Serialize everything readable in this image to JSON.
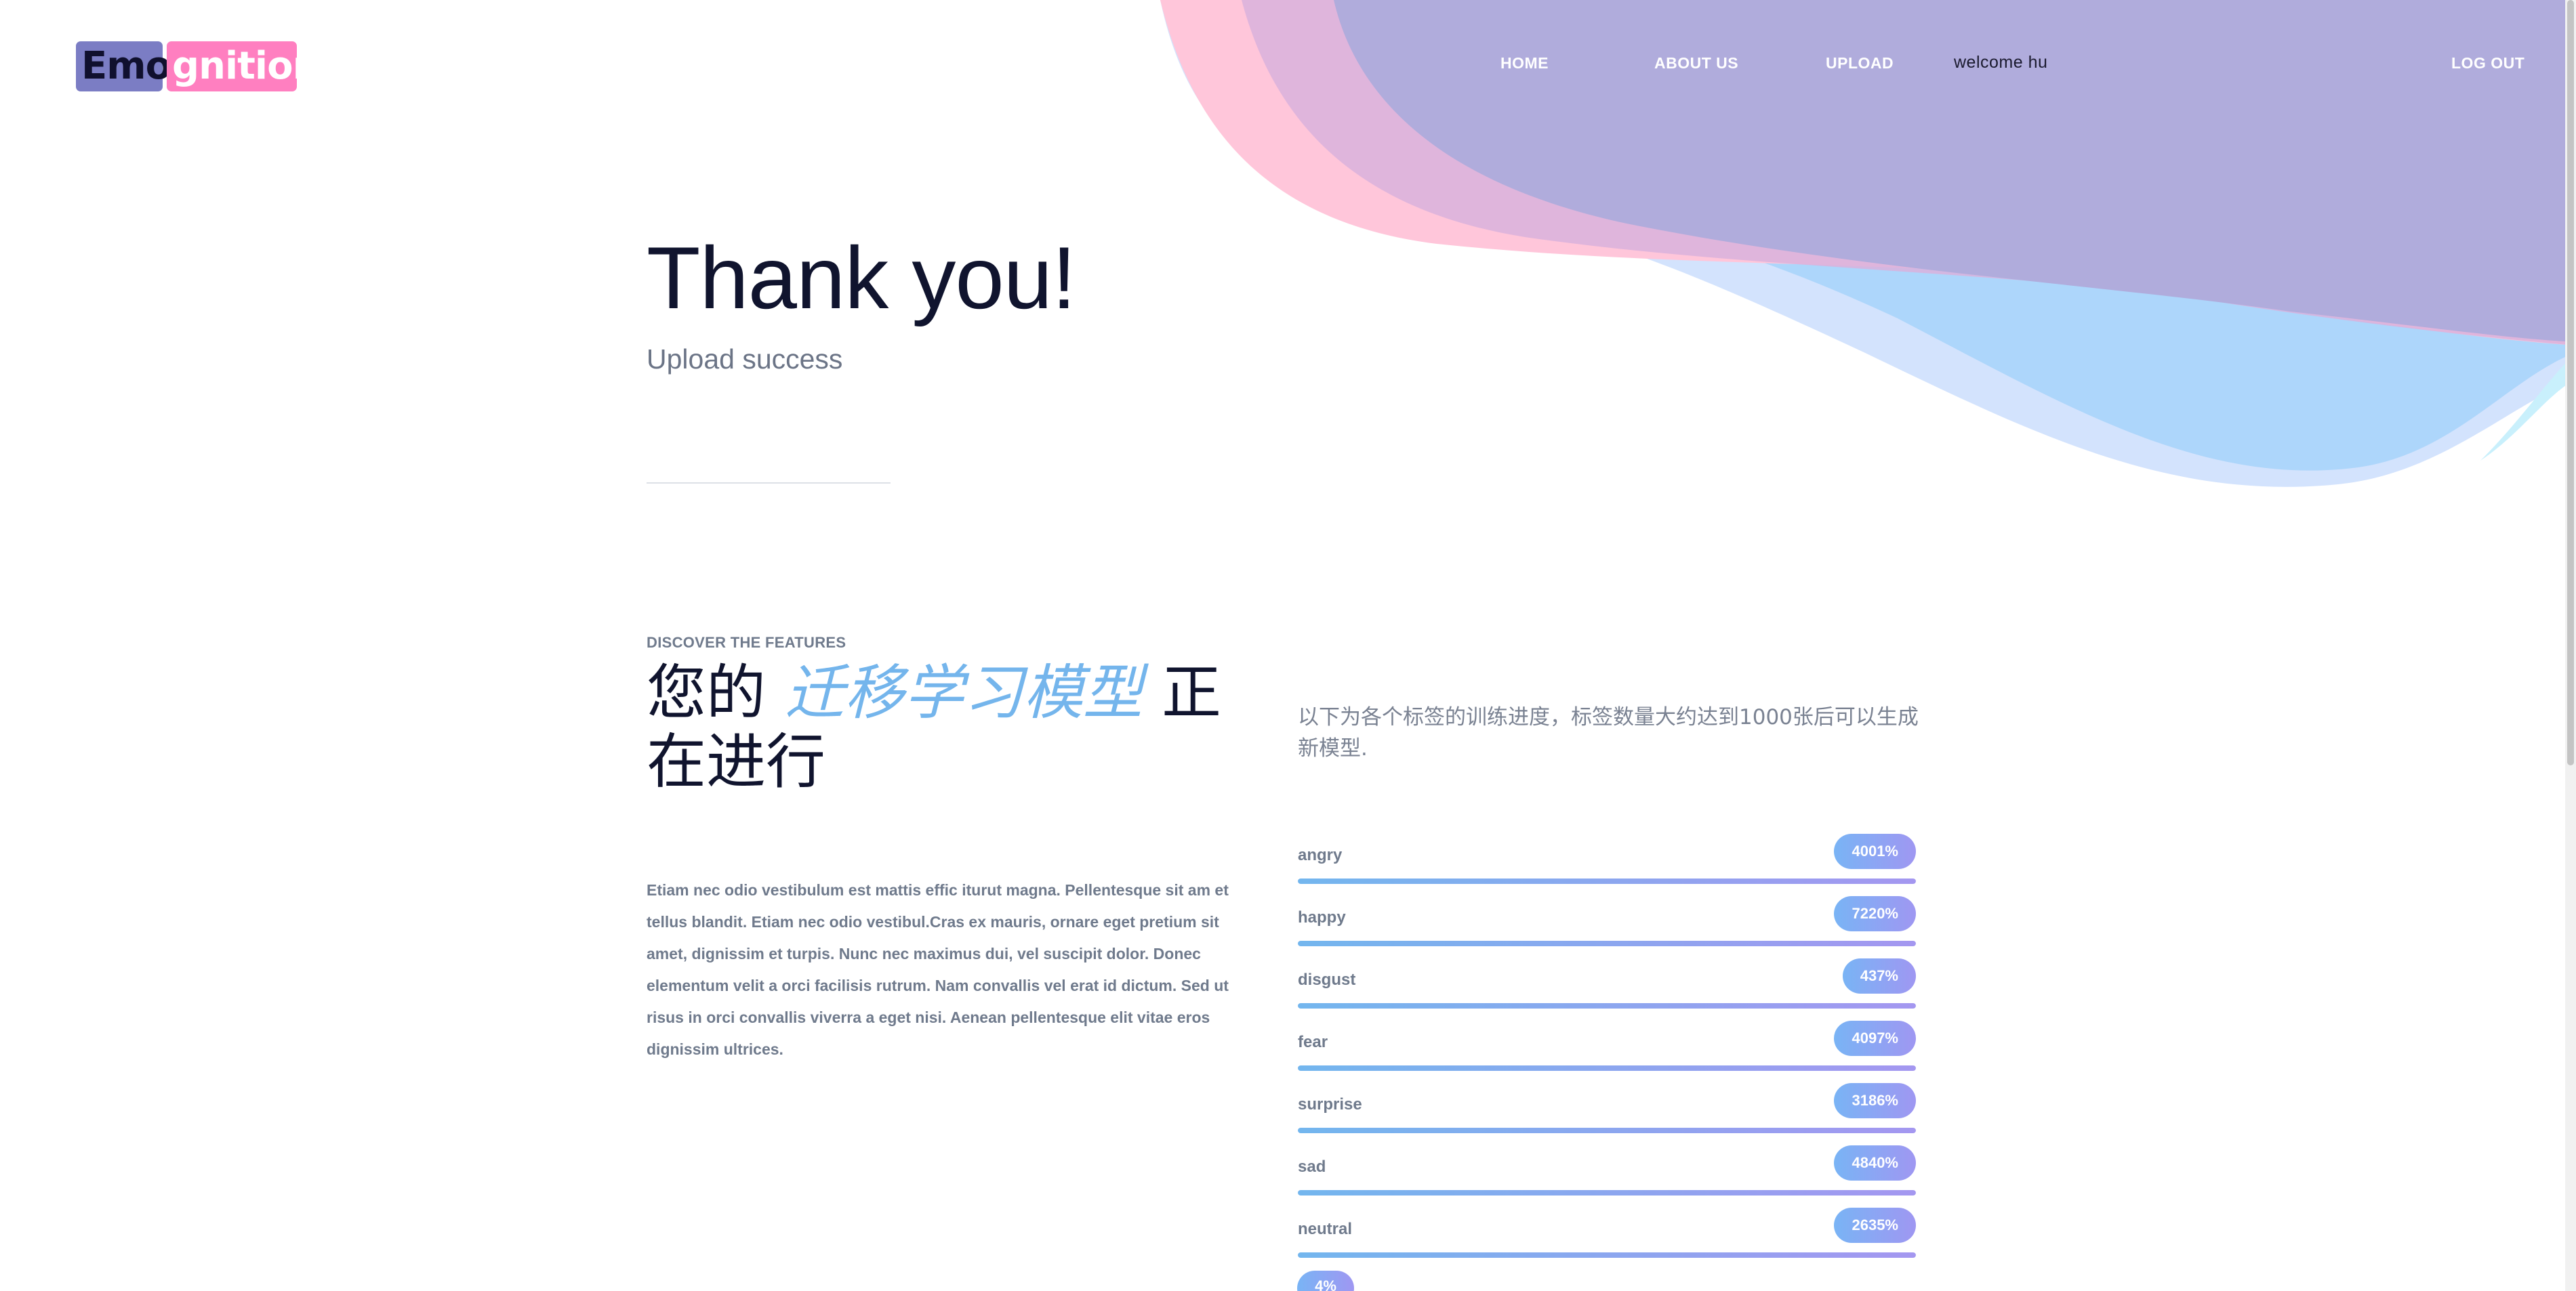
{
  "brand": {
    "logo_part_1": "Emo",
    "logo_part_2": "gnition"
  },
  "nav": {
    "home": "HOME",
    "about": "ABOUT US",
    "upload": "UPLOAD",
    "welcome": "welcome hu",
    "logout": "LOG OUT"
  },
  "hero": {
    "title": "Thank you!",
    "subtitle": "Upload success"
  },
  "features": {
    "kicker": "DISCOVER THE FEATURES",
    "title_pre": "您的 ",
    "title_accent": "迁移学习模型",
    "title_post": " 正在进行",
    "body": "Etiam nec odio vestibulum est mattis effic iturut magna. Pellentesque sit am et tellus blandit. Etiam nec odio vestibul.Cras ex mauris, ornare eget pretium sit amet, dignissim et turpis. Nunc nec maximus dui, vel suscipit dolor. Donec elementum velit a orci facilisis rutrum. Nam convallis vel erat id dictum. Sed ut risus in orci convallis viverra a eget nisi. Aenean pellentesque elit vitae eros dignissim ultrices."
  },
  "progress": {
    "description": "以下为各个标签的训练进度，标签数量大约达到1000张后可以生成新模型.",
    "items": [
      {
        "label": "angry",
        "value": "4001%",
        "fill": 1.0
      },
      {
        "label": "happy",
        "value": "7220%",
        "fill": 1.0
      },
      {
        "label": "disgust",
        "value": "437%",
        "fill": 1.0
      },
      {
        "label": "fear",
        "value": "4097%",
        "fill": 1.0
      },
      {
        "label": "surprise",
        "value": "3186%",
        "fill": 1.0
      },
      {
        "label": "sad",
        "value": "4840%",
        "fill": 1.0
      },
      {
        "label": "neutral",
        "value": "2635%",
        "fill": 1.0
      }
    ],
    "extra_badge": "4%"
  },
  "colors": {
    "accent_blue": "#74b5ec",
    "accent_purple": "#a497f0",
    "pink": "#ff7fc0",
    "dark_text": "#10142e"
  }
}
